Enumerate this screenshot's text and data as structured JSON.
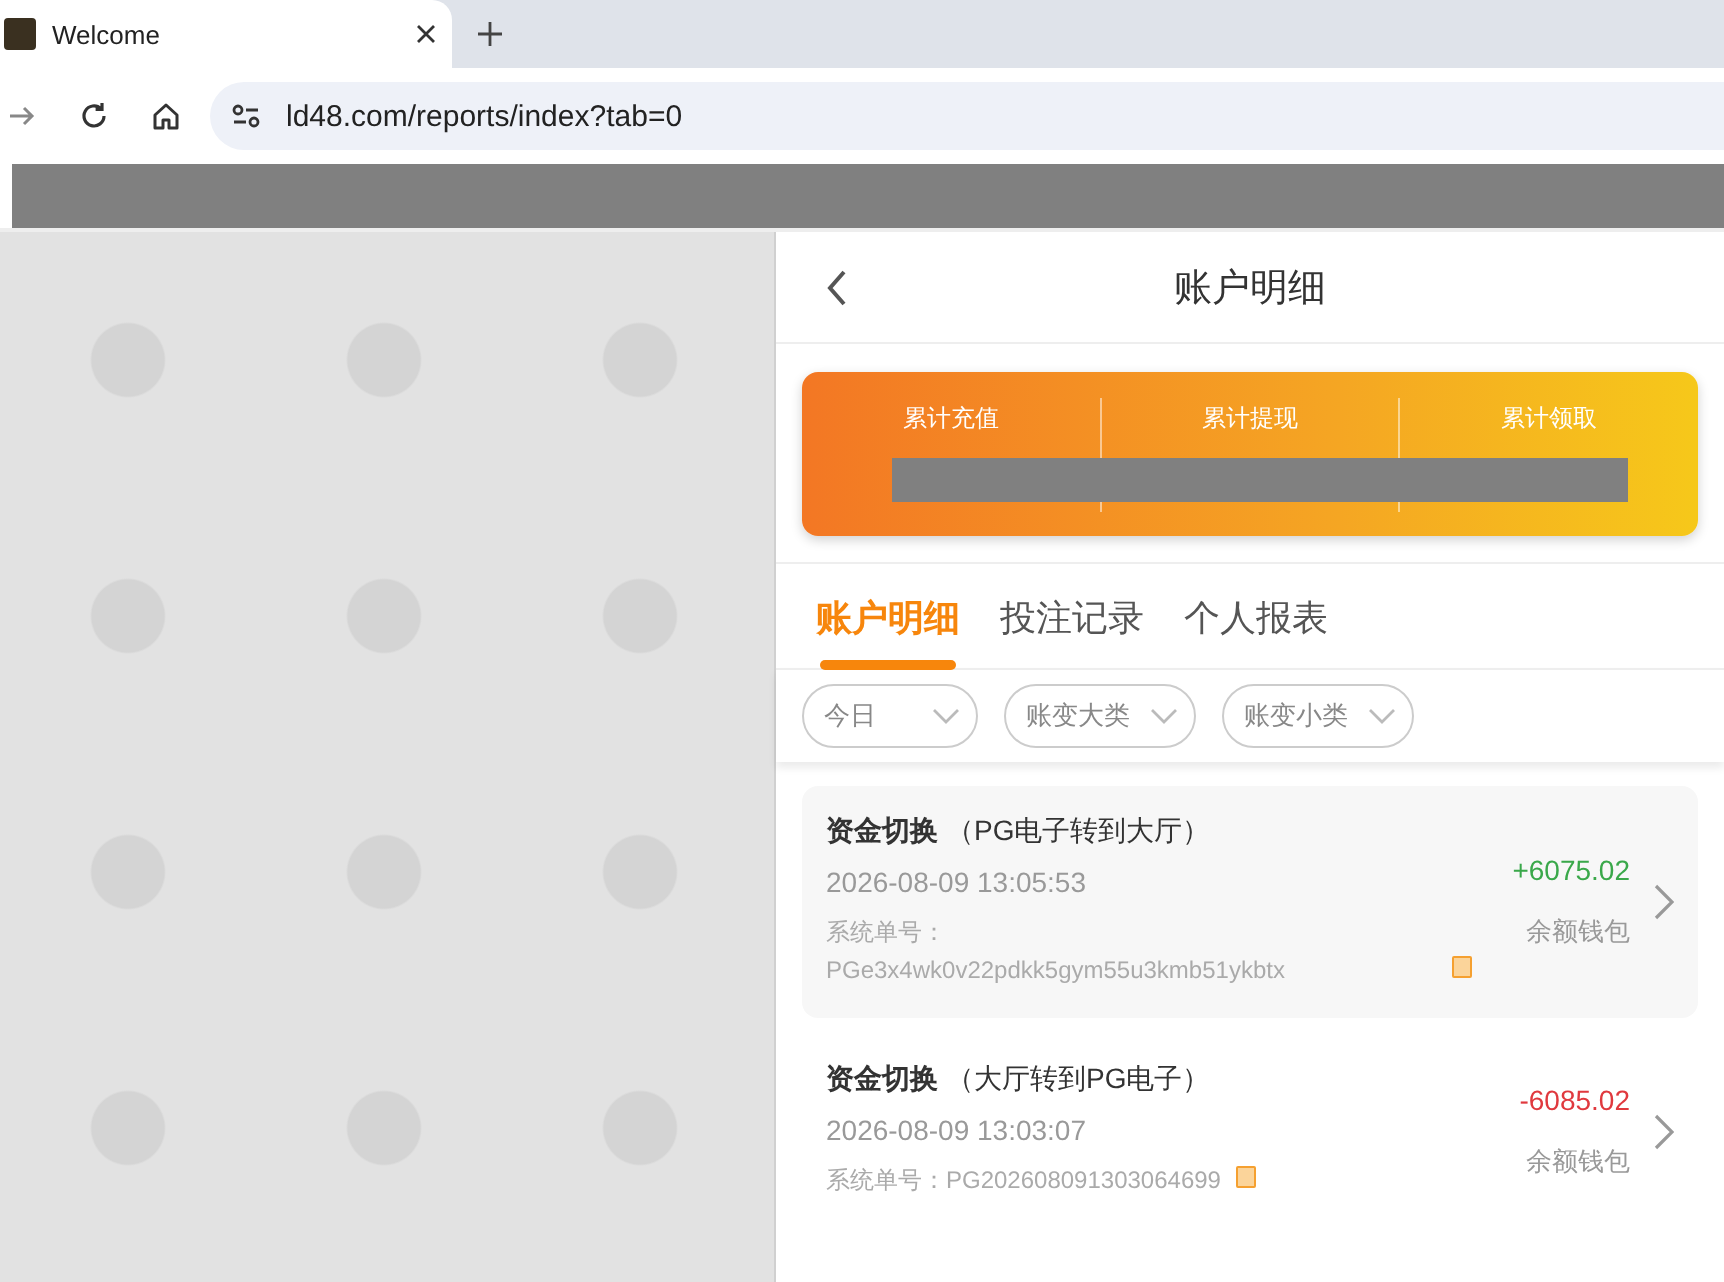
{
  "browser": {
    "tab_title": "Welcome",
    "url": "ld48.com/reports/index?tab=0"
  },
  "header": {
    "title": "账户明细"
  },
  "summary": {
    "labels": [
      "累计充值",
      "累计提现",
      "累计领取"
    ]
  },
  "tabs": [
    {
      "label": "账户明细",
      "selected": true
    },
    {
      "label": "投注记录",
      "selected": false
    },
    {
      "label": "个人报表",
      "selected": false
    }
  ],
  "filters": [
    {
      "label": "今日"
    },
    {
      "label": "账变大类"
    },
    {
      "label": "账变小类"
    }
  ],
  "records": [
    {
      "title": "资金切换",
      "detail": "（PG电子转到大厅）",
      "time": "2026-08-09 13:05:53",
      "order": "系统单号：PGe3x4wk0v22pdkk5gym55u3kmb51ykbtx",
      "amount": "+6075.02",
      "kind": "in",
      "wallet": "余额钱包",
      "selected": true
    },
    {
      "title": "资金切换",
      "detail": "（大厅转到PG电子）",
      "time": "2026-08-09 13:03:07",
      "order": "系统单号：PG202608091303064699",
      "amount": "-6085.02",
      "kind": "out",
      "wallet": "余额钱包",
      "selected": false
    }
  ]
}
